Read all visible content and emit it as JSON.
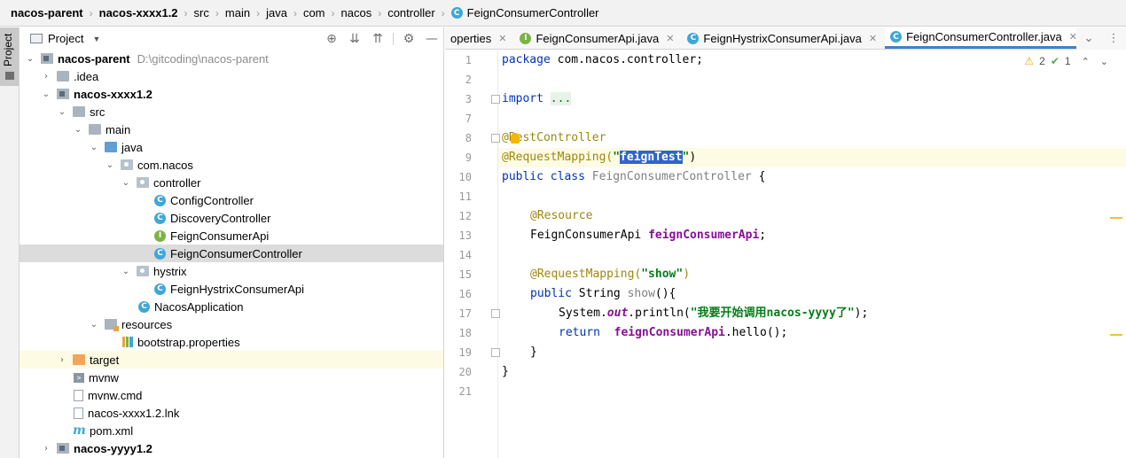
{
  "breadcrumb": {
    "items": [
      "nacos-parent",
      "nacos-xxxx1.2",
      "src",
      "main",
      "java",
      "com",
      "nacos",
      "controller",
      "FeignConsumerController"
    ]
  },
  "side_stripe": {
    "tab_label": "Project"
  },
  "project_panel": {
    "title": "Project",
    "tree": [
      {
        "label": "nacos-parent",
        "path": "D:\\gitcoding\\nacos-parent"
      },
      {
        "label": ".idea"
      },
      {
        "label": "nacos-xxxx1.2"
      },
      {
        "label": "src"
      },
      {
        "label": "main"
      },
      {
        "label": "java"
      },
      {
        "label": "com.nacos"
      },
      {
        "label": "controller"
      },
      {
        "label": "ConfigController"
      },
      {
        "label": "DiscoveryController"
      },
      {
        "label": "FeignConsumerApi"
      },
      {
        "label": "FeignConsumerController"
      },
      {
        "label": "hystrix"
      },
      {
        "label": "FeignHystrixConsumerApi"
      },
      {
        "label": "NacosApplication"
      },
      {
        "label": "resources"
      },
      {
        "label": "bootstrap.properties"
      },
      {
        "label": "target"
      },
      {
        "label": "mvnw"
      },
      {
        "label": "mvnw.cmd"
      },
      {
        "label": "nacos-xxxx1.2.lnk"
      },
      {
        "label": "pom.xml"
      },
      {
        "label": "nacos-yyyy1.2"
      }
    ]
  },
  "editor": {
    "tabs": [
      {
        "label": "operties"
      },
      {
        "label": "FeignConsumerApi.java"
      },
      {
        "label": "FeignHystrixConsumerApi.java"
      },
      {
        "label": "FeignConsumerController.java"
      }
    ],
    "inspections": {
      "warnings": "2",
      "ok": "1"
    },
    "line_numbers": [
      "1",
      "2",
      "3",
      "7",
      "8",
      "9",
      "10",
      "11",
      "12",
      "13",
      "14",
      "15",
      "16",
      "17",
      "18",
      "19",
      "20",
      "21"
    ],
    "code": {
      "l1_kw": "package",
      "l1_rest": " com.nacos.controller;",
      "l3_kw": "import",
      "l3_ellipsis": "...",
      "l8_ann": "@RestController",
      "l9_ann": "@RequestMapping(",
      "l9_q1": "\"",
      "l9_sel": "feignTest",
      "l9_q2": "\"",
      "l9_close": ")",
      "l10_kw": "public class",
      "l10_name": " FeignConsumerController",
      "l10_rest": " {",
      "l12_ann": "@Resource",
      "l13_type": "FeignConsumerApi ",
      "l13_field": "feignConsumerApi",
      "l13_end": ";",
      "l15_ann": "@RequestMapping(",
      "l15_str": "\"show\"",
      "l15_close": ")",
      "l16_kw": "public",
      "l16_type": " String ",
      "l16_name": "show",
      "l16_rest": "(){",
      "l17_pre": "System.",
      "l17_out": "out",
      "l17_mid": ".println(",
      "l17_str": "\"我要开始调用nacos-yyyy了\"",
      "l17_end": ");",
      "l18_kw": "return",
      "l18_field": "  feignConsumerApi",
      "l18_rest": ".hello();",
      "l19": "}",
      "l20": "}"
    }
  }
}
